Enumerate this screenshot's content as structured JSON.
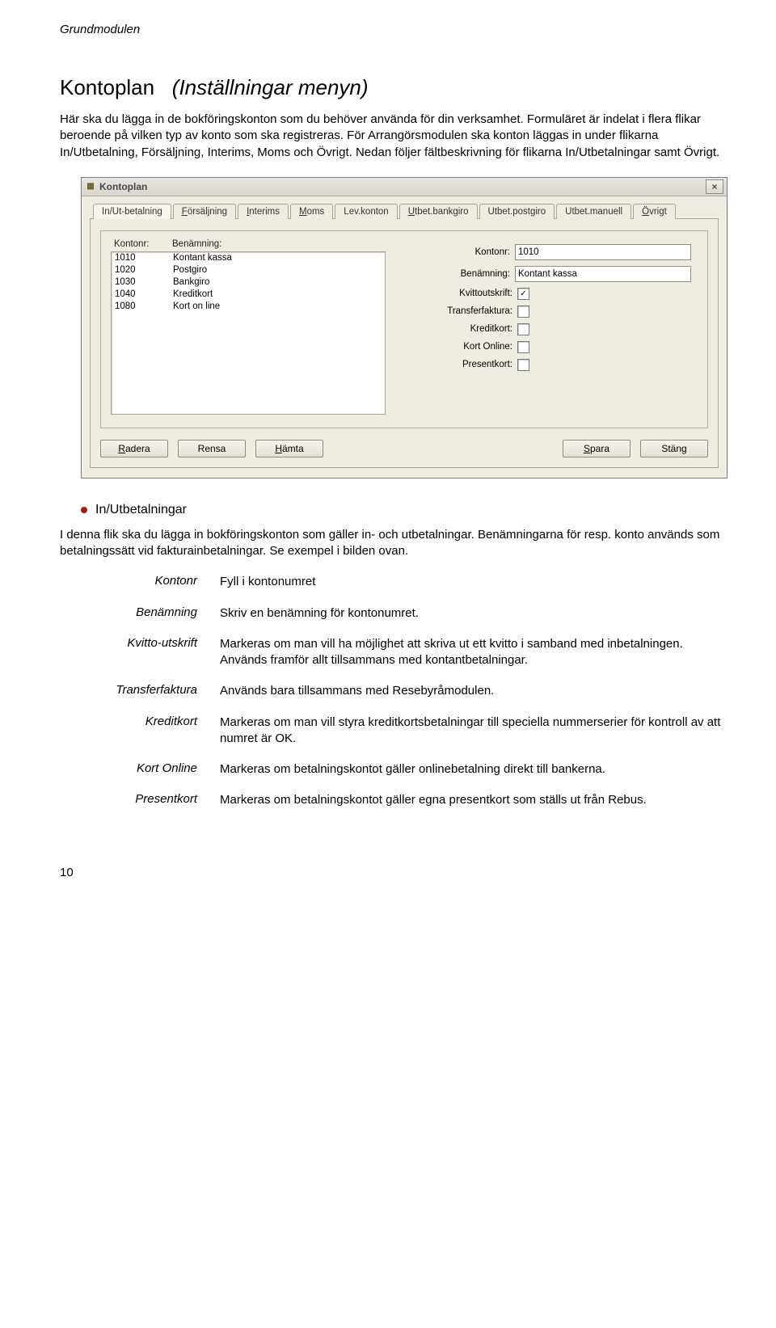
{
  "header": "Grundmodulen",
  "title_main": "Kontoplan",
  "title_sub": "(Inställningar menyn)",
  "intro": "Här ska du lägga in de bokföringskonton som du behöver använda för din verksamhet. Formuläret är indelat i flera flikar beroende på vilken typ av konto som ska registreras. För Arrangörsmodulen ska konton läggas in under flikarna In/Utbetalning, Försäljning, Interims, Moms och Övrigt. Nedan följer fältbeskrivning för flikarna In/Utbetalningar samt Övrigt.",
  "window": {
    "title": "Kontoplan",
    "close": "×",
    "tabs": [
      {
        "u": "",
        "rest": "In/Ut-betalning"
      },
      {
        "u": "F",
        "rest": "örsäljning"
      },
      {
        "u": "I",
        "rest": "nterims"
      },
      {
        "u": "M",
        "rest": "oms"
      },
      {
        "u": "",
        "rest": "Lev.konton"
      },
      {
        "u": "U",
        "rest": "tbet.bankgiro"
      },
      {
        "u": "",
        "rest": "Utbet.postgiro"
      },
      {
        "u": "",
        "rest": "Utbet.manuell"
      },
      {
        "u": "Ö",
        "rest": "vrigt"
      }
    ],
    "list_header": {
      "col1": "Kontonr:",
      "col2": "Benämning:"
    },
    "rows": [
      {
        "nr": "1010",
        "name": "Kontant kassa"
      },
      {
        "nr": "1020",
        "name": "Postgiro"
      },
      {
        "nr": "1030",
        "name": "Bankgiro"
      },
      {
        "nr": "1040",
        "name": "Kreditkort"
      },
      {
        "nr": "1080",
        "name": "Kort on line"
      }
    ],
    "form": {
      "kontonr_label": "Kontonr:",
      "kontonr_value": "1010",
      "benamning_label": "Benämning:",
      "benamning_value": "Kontant kassa",
      "kvitto_label": "Kvittoutskrift:",
      "kvitto_checked": "✓",
      "transfer_label": "Transferfaktura:",
      "kredit_label": "Kreditkort:",
      "kort_label": "Kort Online:",
      "present_label": "Presentkort:"
    },
    "buttons": {
      "radera": {
        "u": "R",
        "rest": "adera"
      },
      "rensa": {
        "u": "",
        "rest": "Rensa"
      },
      "hamta": {
        "u": "H",
        "rest": "ämta"
      },
      "spara": {
        "u": "S",
        "rest": "para"
      },
      "stang": {
        "u": "",
        "rest": "Stäng"
      }
    }
  },
  "section_heading": "In/Utbetalningar",
  "section_intro": "I denna flik ska du lägga in bokföringskonton som gäller in- och utbetalningar. Benämningarna för resp. konto används som betalningssätt vid fakturainbetalningar. Se exempel i bilden ovan.",
  "defs": [
    {
      "term": "Kontonr",
      "desc": "Fyll i kontonumret"
    },
    {
      "term": "Benämning",
      "desc": "Skriv en benämning för kontonumret."
    },
    {
      "term": "Kvitto-utskrift",
      "desc": "Markeras om man vill ha möjlighet att skriva ut ett kvitto i samband med inbetalningen. Används framför allt tillsammans med kontantbetalningar."
    },
    {
      "term": "Transferfaktura",
      "desc": "Används bara tillsammans med Resebyråmodulen."
    },
    {
      "term": "Kreditkort",
      "desc": "Markeras om man vill styra kreditkortsbetalningar till speciella nummerserier för kontroll av att numret är OK."
    },
    {
      "term": "Kort Online",
      "desc": "Markeras om betalningskontot gäller onlinebetalning direkt till bankerna."
    },
    {
      "term": "Presentkort",
      "desc": "Markeras om betalningskontot gäller egna presentkort som ställs ut från Rebus."
    }
  ],
  "page_number": "10"
}
